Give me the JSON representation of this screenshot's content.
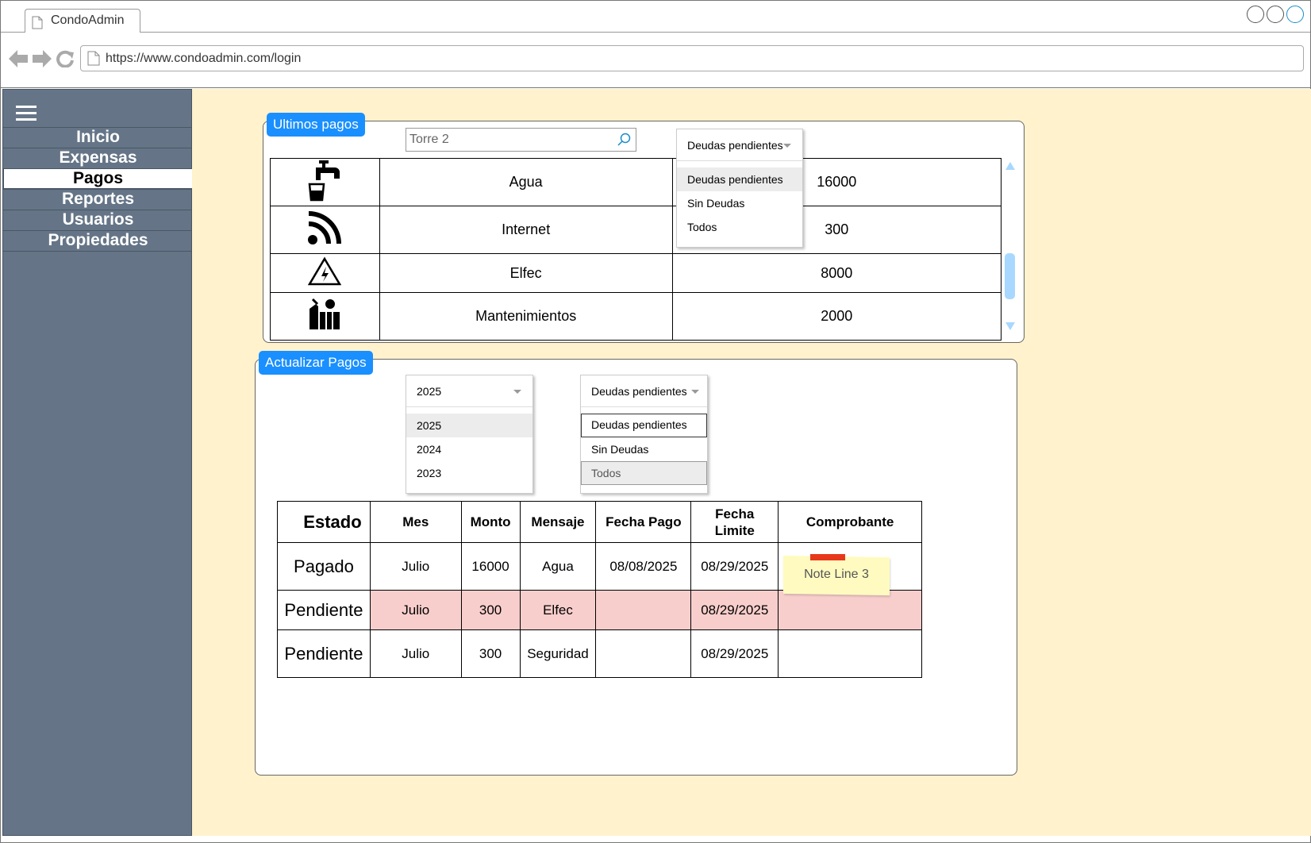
{
  "browser": {
    "tab_title": "CondoAdmin",
    "url": "https://www.condoadmin.com/login"
  },
  "sidebar": {
    "items": [
      {
        "label": "Inicio",
        "active": false
      },
      {
        "label": "Expensas",
        "active": false
      },
      {
        "label": "Pagos",
        "active": true
      },
      {
        "label": "Reportes",
        "active": false
      },
      {
        "label": "Usuarios",
        "active": false
      },
      {
        "label": "Propiedades",
        "active": false
      }
    ]
  },
  "ultimos_pagos": {
    "title": "Ultimos pagos",
    "search_value": "Torre 2",
    "filter": {
      "selected": "Deudas pendientes",
      "options": [
        "Deudas pendientes",
        "Sin Deudas",
        "Todos"
      ]
    },
    "rows": [
      {
        "icon": "water-tap-icon",
        "service": "Agua",
        "amount": "16000"
      },
      {
        "icon": "rss-feed-icon",
        "service": "Internet",
        "amount": "300"
      },
      {
        "icon": "electric-hazard-icon",
        "service": "Elfec",
        "amount": "8000"
      },
      {
        "icon": "maintenance-tools-icon",
        "service": "Mantenimientos",
        "amount": "2000"
      }
    ]
  },
  "actualizar_pagos": {
    "title": "Actualizar Pagos",
    "year_filter": {
      "selected": "2025",
      "options": [
        "2025",
        "2024",
        "2023"
      ]
    },
    "status_filter": {
      "selected": "Deudas pendientes",
      "options": [
        "Deudas pendientes",
        "Sin Deudas",
        "Todos"
      ]
    },
    "table": {
      "headers": {
        "estado": "Estado",
        "mes": "Mes",
        "monto": "Monto",
        "mensaje": "Mensaje",
        "fecha_pago": "Fecha Pago",
        "fecha_limite_1": "Fecha",
        "fecha_limite_2": "Limite",
        "comprobante": "Comprobante"
      },
      "rows": [
        {
          "estado": "Pagado",
          "mes": "Julio",
          "monto": "16000",
          "mensaje": "Agua",
          "fecha_pago": "08/08/2025",
          "fecha_limite": "08/29/2025",
          "comprobante": ""
        },
        {
          "estado": "Pendiente",
          "mes": "Julio",
          "monto": "300",
          "mensaje": "Elfec",
          "fecha_pago": "",
          "fecha_limite": "08/29/2025",
          "comprobante": ""
        },
        {
          "estado": "Pendiente",
          "mes": "Julio",
          "monto": "300",
          "mensaje": "Seguridad",
          "fecha_pago": "",
          "fecha_limite": "08/29/2025",
          "comprobante": ""
        }
      ]
    },
    "note": "Note Line 3"
  },
  "colors": {
    "sidebar_bg": "#657587",
    "content_bg": "#fff2cc",
    "accent": "#1a8fff",
    "pending_row": "#f8cecc",
    "note_bg": "#fffbc0"
  }
}
